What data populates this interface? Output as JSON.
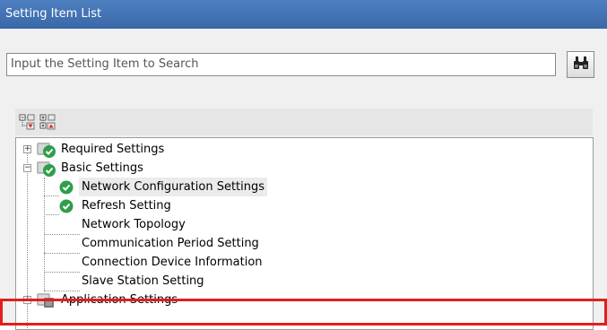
{
  "window": {
    "title": "Setting Item List"
  },
  "search": {
    "placeholder": "Input the Setting Item to Search",
    "button_icon": "binoculars-icon"
  },
  "toolbar": {
    "buttons": [
      {
        "icon": "expand-all-icon"
      },
      {
        "icon": "collapse-all-icon"
      }
    ]
  },
  "tree": {
    "items": [
      {
        "label": "Required Settings",
        "level": 0,
        "expander": "+",
        "icon": "folder-check-icon"
      },
      {
        "label": "Basic Settings",
        "level": 0,
        "expander": "-",
        "icon": "folder-check-icon"
      },
      {
        "label": "Network Configuration Settings",
        "level": 1,
        "icon": "check-icon",
        "selected": true
      },
      {
        "label": "Refresh Setting",
        "level": 1,
        "icon": "check-icon"
      },
      {
        "label": "Network Topology",
        "level": 1
      },
      {
        "label": "Communication Period Setting",
        "level": 1
      },
      {
        "label": "Connection Device Information",
        "level": 1
      },
      {
        "label": "Slave Station Setting",
        "level": 1
      },
      {
        "label": "Application Settings",
        "level": 0,
        "expander": "+",
        "icon": "folder-gray-icon"
      }
    ]
  },
  "colors": {
    "titlebar": "#3f6fb2",
    "check": "#2e9e4a",
    "highlight": "#e0201c"
  }
}
